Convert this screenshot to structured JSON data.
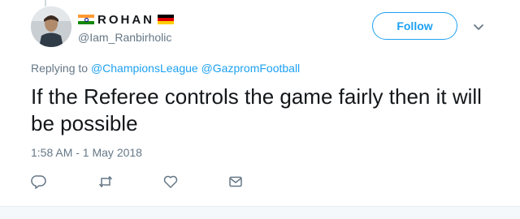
{
  "tweet": {
    "display_name": "ROHAN",
    "handle": "@Iam_Ranbirholic",
    "follow_label": "Follow",
    "replying_prefix": "Replying to",
    "reply_mentions": [
      "@ChampionsLeague",
      "@GazpromFootball"
    ],
    "text": "If the Referee controls the game fairly then it will be possible",
    "timestamp": "1:58 AM - 1 May 2018"
  },
  "icons": {
    "reply": "reply-icon",
    "retweet": "retweet-icon",
    "like": "heart-icon",
    "message": "envelope-icon",
    "menu": "chevron-down-icon"
  },
  "colors": {
    "accent": "#1da1f2",
    "muted": "#657786",
    "text": "#14171a",
    "divider": "#e6ecf0"
  }
}
